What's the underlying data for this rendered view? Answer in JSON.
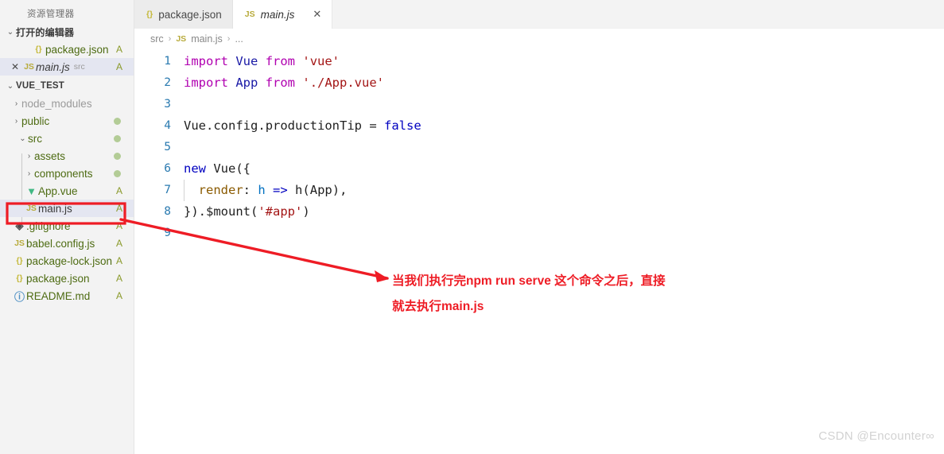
{
  "sidebar": {
    "title": "资源管理器",
    "open_editors": {
      "label": "打开的编辑器",
      "chevron": "⌄",
      "items": [
        {
          "name": "package.json",
          "icon": "json-braces-icon",
          "icon_glyph": "{}",
          "badge": "A",
          "sub": "",
          "selected": false,
          "closable": false
        },
        {
          "name": "main.js",
          "icon": "js-file-icon",
          "icon_glyph": "JS",
          "badge": "A",
          "sub": "src",
          "selected": true,
          "closable": true,
          "close_glyph": "✕"
        }
      ]
    },
    "project": {
      "label": "VUE_TEST",
      "chevron": "⌄",
      "items": [
        {
          "name": "node_modules",
          "type": "folder",
          "twisty": "›",
          "indent": 1,
          "icon_glyph": "",
          "badge": "",
          "dot": false,
          "muted": true
        },
        {
          "name": "public",
          "type": "folder",
          "twisty": "›",
          "indent": 1,
          "icon_glyph": "",
          "badge": "",
          "dot": true,
          "muted": false
        },
        {
          "name": "src",
          "type": "folder",
          "twisty": "⌄",
          "indent": 1,
          "icon_glyph": "",
          "badge": "",
          "dot": true,
          "muted": false
        },
        {
          "name": "assets",
          "type": "folder",
          "twisty": "›",
          "indent": 2,
          "icon_glyph": "",
          "badge": "",
          "dot": true,
          "muted": false
        },
        {
          "name": "components",
          "type": "folder",
          "twisty": "›",
          "indent": 2,
          "icon_glyph": "",
          "badge": "",
          "dot": true,
          "muted": false
        },
        {
          "name": "App.vue",
          "type": "file",
          "twisty": "",
          "indent": 2,
          "icon": "vue-file-icon",
          "icon_glyph": "V",
          "badge": "A",
          "dot": false,
          "muted": false
        },
        {
          "name": "main.js",
          "type": "file",
          "twisty": "",
          "indent": 2,
          "icon": "js-file-icon",
          "icon_glyph": "JS",
          "badge": "A",
          "dot": false,
          "muted": false,
          "selected": true,
          "highlighted": true
        },
        {
          "name": ".gitignore",
          "type": "file",
          "twisty": "",
          "indent": 1,
          "icon": "git-file-icon",
          "icon_glyph": "◈",
          "badge": "A",
          "dot": false,
          "muted": false
        },
        {
          "name": "babel.config.js",
          "type": "file",
          "twisty": "",
          "indent": 1,
          "icon": "js-file-icon",
          "icon_glyph": "JS",
          "badge": "A",
          "dot": false,
          "muted": false
        },
        {
          "name": "package-lock.json",
          "type": "file",
          "twisty": "",
          "indent": 1,
          "icon": "json-braces-icon",
          "icon_glyph": "{}",
          "badge": "A",
          "dot": false,
          "muted": false
        },
        {
          "name": "package.json",
          "type": "file",
          "twisty": "",
          "indent": 1,
          "icon": "json-braces-icon",
          "icon_glyph": "{}",
          "badge": "A",
          "dot": false,
          "muted": false
        },
        {
          "name": "README.md",
          "type": "file",
          "twisty": "",
          "indent": 1,
          "icon": "info-circle-icon",
          "icon_glyph": "ⓘ",
          "badge": "A",
          "dot": false,
          "muted": false
        }
      ]
    }
  },
  "tabs": [
    {
      "label": "package.json",
      "icon_glyph": "{}",
      "icon": "json-braces-icon",
      "active": false,
      "closable": false
    },
    {
      "label": "main.js",
      "icon_glyph": "JS",
      "icon": "js-file-icon",
      "active": true,
      "closable": true,
      "close_glyph": "✕"
    }
  ],
  "breadcrumb": {
    "parts": [
      "src",
      "main.js",
      "..."
    ],
    "separator": "›",
    "file_icon_glyph": "JS"
  },
  "code": {
    "lines": [
      {
        "n": "1",
        "tokens": [
          {
            "t": "import",
            "c": "kw"
          },
          {
            "t": " ",
            "c": "op"
          },
          {
            "t": "Vue",
            "c": "cls"
          },
          {
            "t": " ",
            "c": "op"
          },
          {
            "t": "from",
            "c": "kw"
          },
          {
            "t": " ",
            "c": "op"
          },
          {
            "t": "'vue'",
            "c": "str"
          }
        ]
      },
      {
        "n": "2",
        "tokens": [
          {
            "t": "import",
            "c": "kw"
          },
          {
            "t": " ",
            "c": "op"
          },
          {
            "t": "App",
            "c": "cls"
          },
          {
            "t": " ",
            "c": "op"
          },
          {
            "t": "from",
            "c": "kw"
          },
          {
            "t": " ",
            "c": "op"
          },
          {
            "t": "'./App.vue'",
            "c": "str"
          }
        ]
      },
      {
        "n": "3",
        "tokens": []
      },
      {
        "n": "4",
        "tokens": [
          {
            "t": "Vue",
            "c": "ident"
          },
          {
            "t": ".",
            "c": "op"
          },
          {
            "t": "config",
            "c": "ident"
          },
          {
            "t": ".",
            "c": "op"
          },
          {
            "t": "productionTip",
            "c": "ident"
          },
          {
            "t": " = ",
            "c": "op"
          },
          {
            "t": "false",
            "c": "blue"
          }
        ]
      },
      {
        "n": "5",
        "tokens": []
      },
      {
        "n": "6",
        "tokens": [
          {
            "t": "new",
            "c": "blue"
          },
          {
            "t": " ",
            "c": "op"
          },
          {
            "t": "Vue",
            "c": "ident"
          },
          {
            "t": "({",
            "c": "op"
          }
        ]
      },
      {
        "n": "7",
        "tokens": [
          {
            "t": "  ",
            "c": "op"
          },
          {
            "t": "render",
            "c": "prop"
          },
          {
            "t": ": ",
            "c": "op"
          },
          {
            "t": "h",
            "c": "param"
          },
          {
            "t": " ",
            "c": "op"
          },
          {
            "t": "=>",
            "c": "blue"
          },
          {
            "t": " ",
            "c": "op"
          },
          {
            "t": "h",
            "c": "ident"
          },
          {
            "t": "(",
            "c": "op"
          },
          {
            "t": "App",
            "c": "ident"
          },
          {
            "t": "),",
            "c": "op"
          }
        ],
        "indent_guide": true
      },
      {
        "n": "8",
        "tokens": [
          {
            "t": "}).",
            "c": "op"
          },
          {
            "t": "$mount",
            "c": "ident"
          },
          {
            "t": "(",
            "c": "op"
          },
          {
            "t": "'#app'",
            "c": "str"
          },
          {
            "t": ")",
            "c": "op"
          }
        ]
      },
      {
        "n": "9",
        "tokens": []
      }
    ]
  },
  "annotation": {
    "line1": "当我们执行完npm run serve  这个命令之后，直接",
    "line2": "就去执行main.js",
    "color": "#ee1c25"
  },
  "watermark": "CSDN @Encounter∞"
}
